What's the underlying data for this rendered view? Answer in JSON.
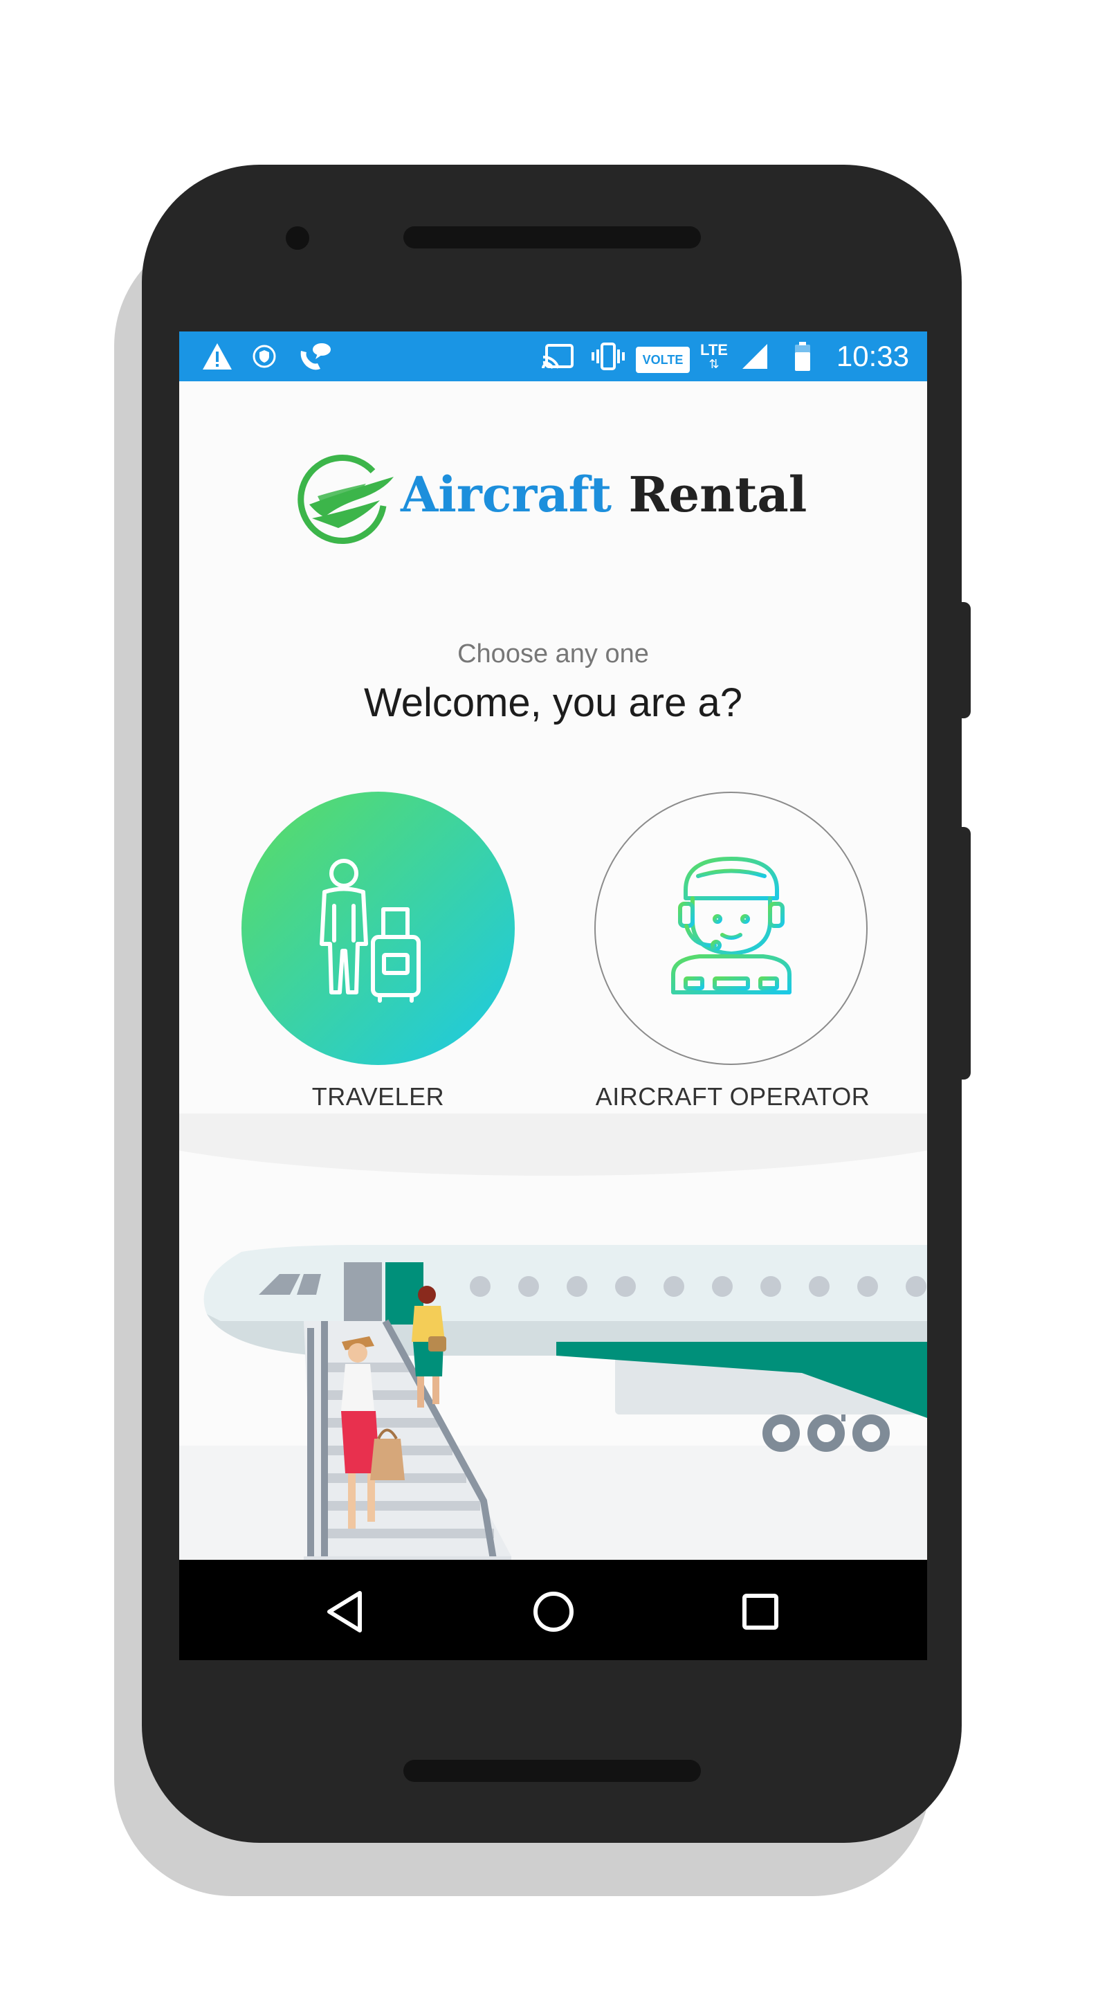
{
  "status_bar": {
    "time": "10:33",
    "volte_label": "VOLTE",
    "lte_label": "LTE",
    "icons": [
      "warning-icon",
      "shield-icon",
      "wifi-calling-icon",
      "cast-icon",
      "vibrate-icon",
      "volte-icon",
      "lte-icon",
      "signal-icon",
      "battery-icon"
    ]
  },
  "logo": {
    "word1": "Aircraft",
    "word2": "Rental",
    "brand_color": "#1d8fdc",
    "mark_color": "#3cb54a"
  },
  "header": {
    "subtitle": "Choose any one",
    "title": "Welcome, you are a?"
  },
  "choices": [
    {
      "label": "TRAVELER",
      "icon": "traveler-luggage-icon",
      "selected": true
    },
    {
      "label": "AIRCRAFT OPERATOR",
      "icon": "pilot-icon",
      "selected": false
    }
  ],
  "illustration": "airplane-boarding-illustration",
  "nav": {
    "buttons": [
      "back-icon",
      "home-icon",
      "recents-icon"
    ]
  },
  "colors": {
    "status_bar": "#1a95e4",
    "gradient_start": "#5cdc62",
    "gradient_end": "#1bc9e6",
    "plane_wing": "#00907a"
  }
}
